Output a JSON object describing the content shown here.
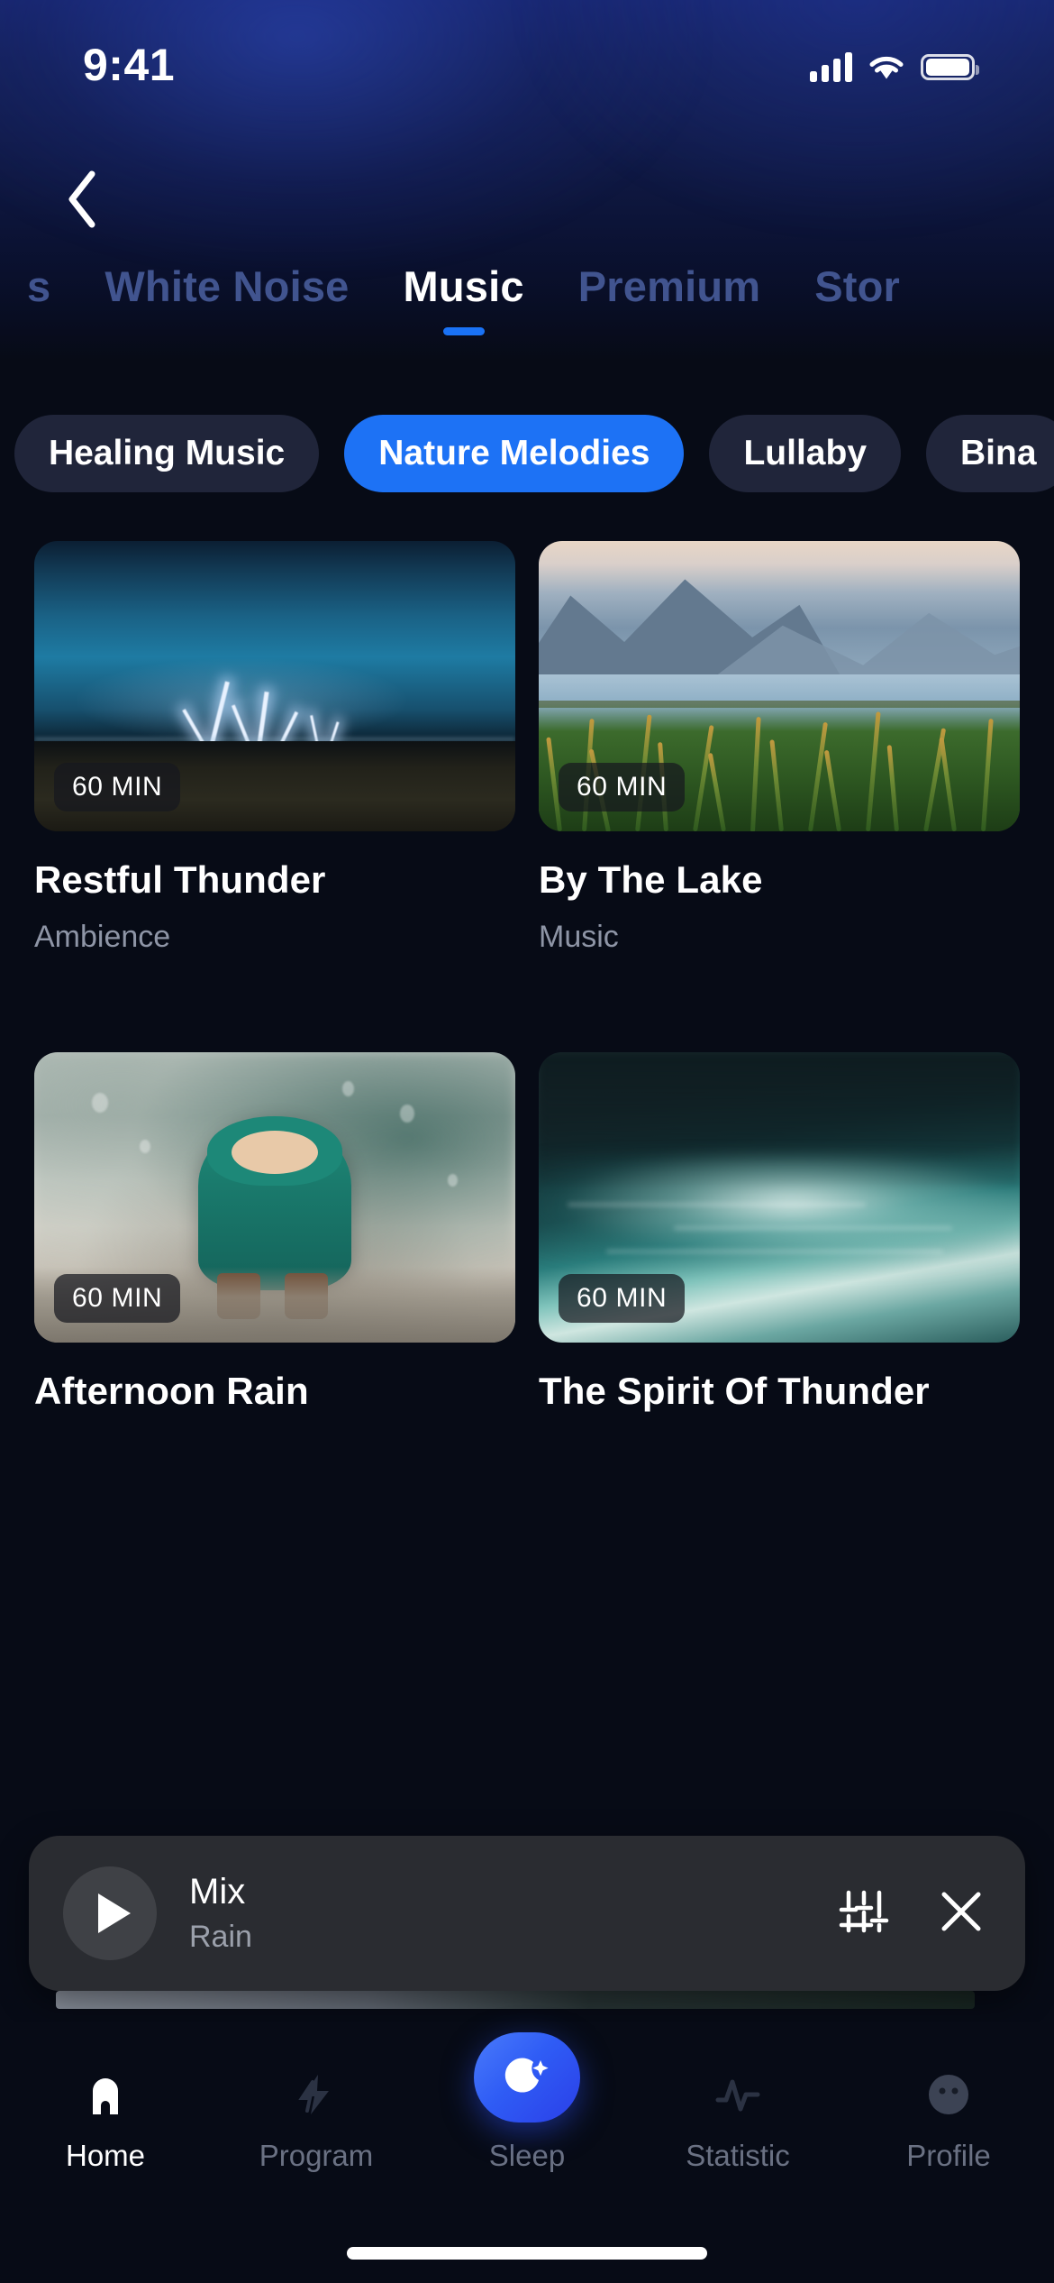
{
  "status_bar": {
    "time": "9:41",
    "cellular_icon": "signal-bars-icon",
    "wifi_icon": "wifi-icon",
    "battery_icon": "battery-icon"
  },
  "header": {
    "back_icon": "back-chevron-icon"
  },
  "tabs": [
    {
      "label": "s",
      "active": false
    },
    {
      "label": "White Noise",
      "active": false
    },
    {
      "label": "Music",
      "active": true
    },
    {
      "label": "Premium",
      "active": false
    },
    {
      "label": "Stor",
      "active": false
    }
  ],
  "chips": [
    {
      "label": "Healing Music",
      "active": false
    },
    {
      "label": "Nature Melodies",
      "active": true
    },
    {
      "label": "Lullaby",
      "active": false
    },
    {
      "label": "Bina",
      "active": false
    }
  ],
  "cards": [
    {
      "title": "Restful Thunder",
      "subtitle": "Ambience",
      "duration": "60 MIN",
      "art": "thunder"
    },
    {
      "title": "By The Lake",
      "subtitle": "Music",
      "duration": "60 MIN",
      "art": "lake"
    },
    {
      "title": "Afternoon Rain",
      "subtitle": "",
      "duration": "60 MIN",
      "art": "rain"
    },
    {
      "title": "The Spirit Of Thunder",
      "subtitle": "",
      "duration": "60 MIN",
      "art": "storm"
    }
  ],
  "player": {
    "play_icon": "play-icon",
    "title": "Mix",
    "subtitle": "Rain",
    "equalizer_icon": "equalizer-sliders-icon",
    "close_icon": "close-x-icon"
  },
  "bottom_nav": {
    "items": [
      {
        "label": "Home",
        "icon": "home-icon",
        "active": true
      },
      {
        "label": "Program",
        "icon": "program-icon",
        "active": false
      },
      {
        "label": "Sleep",
        "icon": "moon-icon",
        "active": false
      },
      {
        "label": "Statistic",
        "icon": "pulse-icon",
        "active": false
      },
      {
        "label": "Profile",
        "icon": "profile-icon",
        "active": false
      }
    ],
    "fab_icon": "moon-star-icon"
  },
  "colors": {
    "accent_blue": "#1d72f5",
    "background": "#070b16",
    "header_gradient_top": "#17256b",
    "chip_inactive": "#20253a",
    "player_bg": "#2a2c31",
    "muted_text": "#8e95a6"
  }
}
